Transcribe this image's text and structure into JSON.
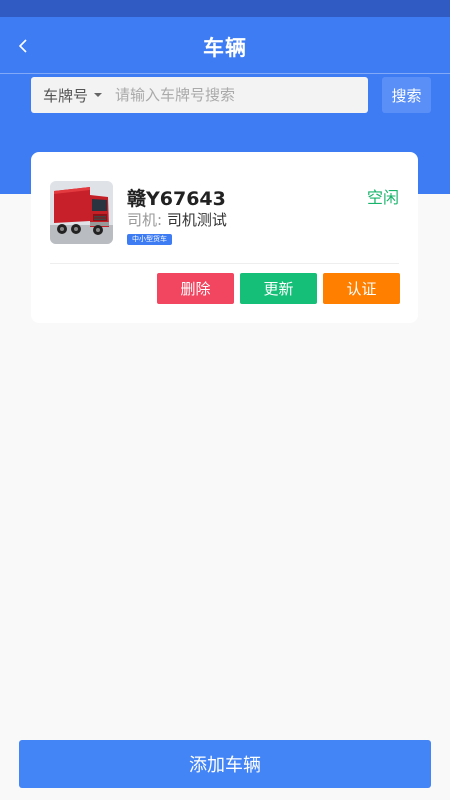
{
  "header": {
    "title": "车辆"
  },
  "search": {
    "filter_label": "车牌号",
    "placeholder": "请输入车牌号搜索",
    "button_label": "搜索"
  },
  "vehicles": [
    {
      "plate": "赣Y67643",
      "status": "空闲",
      "driver_label": "司机:",
      "driver_name": "司机测试",
      "type_tag": "中小型货车",
      "actions": {
        "delete": "删除",
        "update": "更新",
        "certify": "认证"
      }
    }
  ],
  "footer": {
    "add_label": "添加车辆"
  },
  "colors": {
    "primary": "#3e7cf4",
    "status_idle": "#19b46b",
    "delete": "#f2455f",
    "update": "#16bf78",
    "certify": "#ff7f00"
  },
  "icons": {
    "back": "chevron-left-icon",
    "dropdown": "caret-down-icon",
    "vehicle_photo": "truck-icon"
  }
}
